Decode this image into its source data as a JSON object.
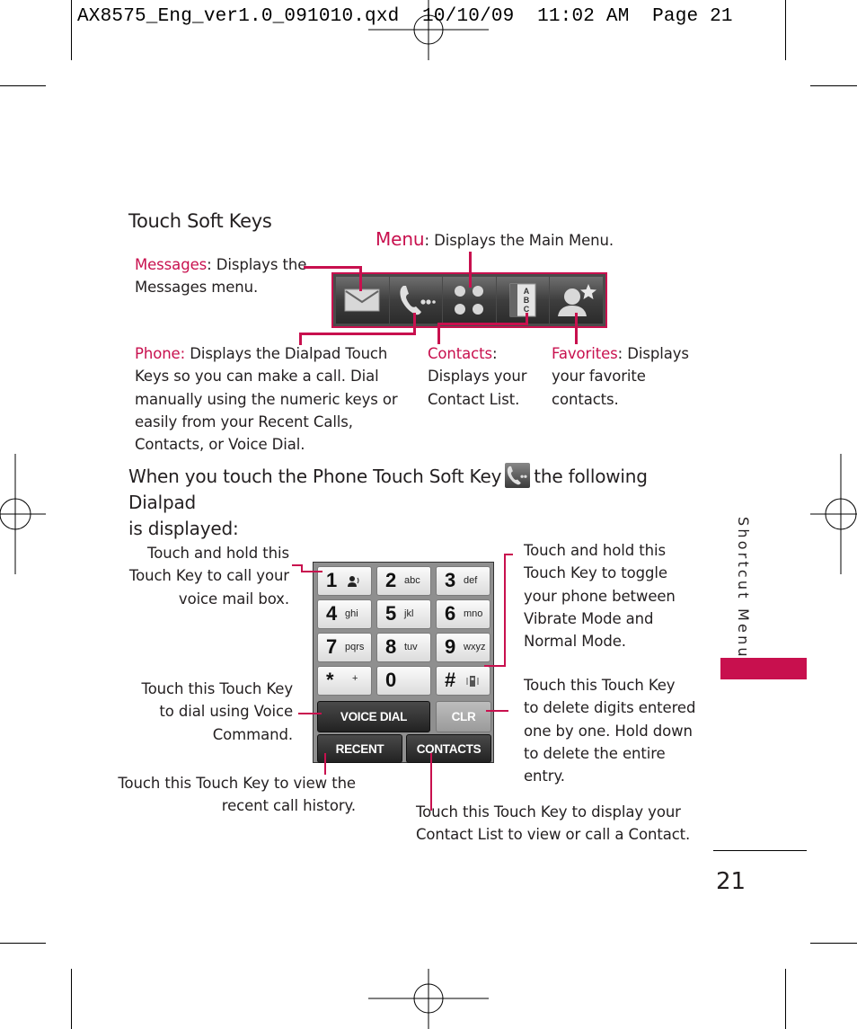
{
  "print_slug": "AX8575_Eng_ver1.0_091010.qxd  10/10/09  11:02 AM  Page 21",
  "section_heading": "Touch Soft Keys",
  "accent_color": "#c8104e",
  "soft_keys": {
    "icons": [
      "messages-icon",
      "phone-icon",
      "menu-icon",
      "contacts-icon",
      "favorites-icon"
    ],
    "callouts": {
      "menu": {
        "term": "Menu",
        "desc": ": Displays the Main Menu."
      },
      "messages": {
        "term": "Messages",
        "desc_line1": ": Displays the",
        "desc_line2": "Messages menu."
      },
      "phone": {
        "term": "Phone:",
        "desc_line1": " Displays the Dialpad Touch",
        "desc_line2": "Keys so you can make a call. Dial",
        "desc_line3": "manually using the numeric keys or",
        "desc_line4": "easily from your Recent Calls,",
        "desc_line5": "Contacts, or Voice Dial."
      },
      "contacts": {
        "term": "Contacts",
        "desc_line1": ":",
        "desc_line2": "Displays your",
        "desc_line3": "Contact List."
      },
      "favorites": {
        "term": "Favorites",
        "desc_line1": ": Displays",
        "desc_line2": "your favorite",
        "desc_line3": "contacts."
      }
    }
  },
  "intro": {
    "line1_before": "When you touch the Phone Touch Soft Key",
    "line1_after": "the following Dialpad",
    "line2": "is displayed:"
  },
  "dialpad": {
    "keys": [
      {
        "num": "1",
        "sub": "voicemail-icon"
      },
      {
        "num": "2",
        "sub": "abc"
      },
      {
        "num": "3",
        "sub": "def"
      },
      {
        "num": "4",
        "sub": "ghi"
      },
      {
        "num": "5",
        "sub": "jkl"
      },
      {
        "num": "6",
        "sub": "mno"
      },
      {
        "num": "7",
        "sub": "pqrs"
      },
      {
        "num": "8",
        "sub": "tuv"
      },
      {
        "num": "9",
        "sub": "wxyz"
      },
      {
        "num": "*",
        "sub": "+"
      },
      {
        "num": "0",
        "sub": ""
      },
      {
        "num": "#",
        "sub": "vibrate-icon"
      }
    ],
    "voice_dial_label": "VOICE DIAL",
    "clr_label": "CLR",
    "recent_label": "RECENT",
    "contacts_label": "CONTACTS"
  },
  "dialpad_callouts": {
    "voicemail": [
      "Touch and hold this",
      "Touch Key to call your",
      "voice mail box."
    ],
    "voice_command": [
      "Touch this Touch Key",
      "to dial using Voice",
      "Command."
    ],
    "recent": [
      "Touch this Touch Key to view the",
      "recent call history."
    ],
    "vibrate": [
      "Touch and hold this",
      "Touch Key to toggle",
      "your phone between",
      "Vibrate Mode and",
      "Normal Mode."
    ],
    "clear": [
      "Touch this Touch Key",
      "to delete digits entered",
      "one by one. Hold down",
      "to delete the entire",
      "entry."
    ],
    "contacts": [
      "Touch this Touch Key to display your",
      "Contact List to view or call a Contact."
    ]
  },
  "side_label": "Shortcut Menu",
  "page_number": "21"
}
